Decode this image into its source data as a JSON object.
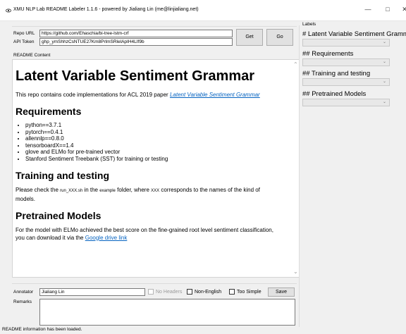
{
  "window": {
    "title": "XMU NLP Lab README Labeler 1.1.6 - powered by Jialiang Lin (me@linjialiang.net)",
    "min_glyph": "—",
    "max_glyph": "□",
    "close_glyph": "✕"
  },
  "repo": {
    "url_label": "Repo URL",
    "url_value": "https://github.com/Ehaschia/bi-tree-lstm-crf",
    "token_label": "API Token",
    "token_value": "ghp_ymShhzCsNTUE27Km8PrlmSRlelApIH4LIf9b",
    "get_label": "Get",
    "go_label": "Go"
  },
  "readme": {
    "section_label": "README Content",
    "h1": "Latent Variable Sentiment Grammar",
    "intro_text": "This repo contains code implementations for ACL 2019 paper ",
    "intro_link": "Latent Variable Sentiment Grammar",
    "h2_requirements": "Requirements",
    "requirements": [
      "python==3.7.1",
      "pytorch==0.4.1",
      "allennlp==0.8.0",
      "tensorboardX==1.4",
      "glove and ELMo for pre-trained vector",
      "Stanford Sentiment Treebank (SST) for training or testing"
    ],
    "h2_training": "Training and testing",
    "training_p1": "Please check the ",
    "training_code1": "run_XXX.sh",
    "training_p2": " in the ",
    "training_code2": "example",
    "training_p3": " folder, where ",
    "training_code3": "XXX",
    "training_p4": " corresponds to the names of the kind of models.",
    "h2_pretrained": "Pretrained Models",
    "pretrained_text": "For the model with ELMo achieved the best score on the fine-grained root level sentiment classification, you can download it via the ",
    "pretrained_link": "Google drive link"
  },
  "annotator": {
    "label": "Annotator",
    "value": "Jialiang Lin",
    "no_headers": "No Headers",
    "non_english": "Non-English",
    "too_simple": "Too Simple",
    "save_label": "Save",
    "remarks_label": "Remarks",
    "remarks_value": ""
  },
  "labels": {
    "section_label": "Labels",
    "items": [
      {
        "title": "# Latent Variable Sentiment Grammar",
        "selected": ""
      },
      {
        "title": "## Requirements",
        "selected": ""
      },
      {
        "title": "## Training and testing",
        "selected": ""
      },
      {
        "title": "## Pretrained Models",
        "selected": ""
      }
    ]
  },
  "status": {
    "text": "README information has been loaded."
  }
}
